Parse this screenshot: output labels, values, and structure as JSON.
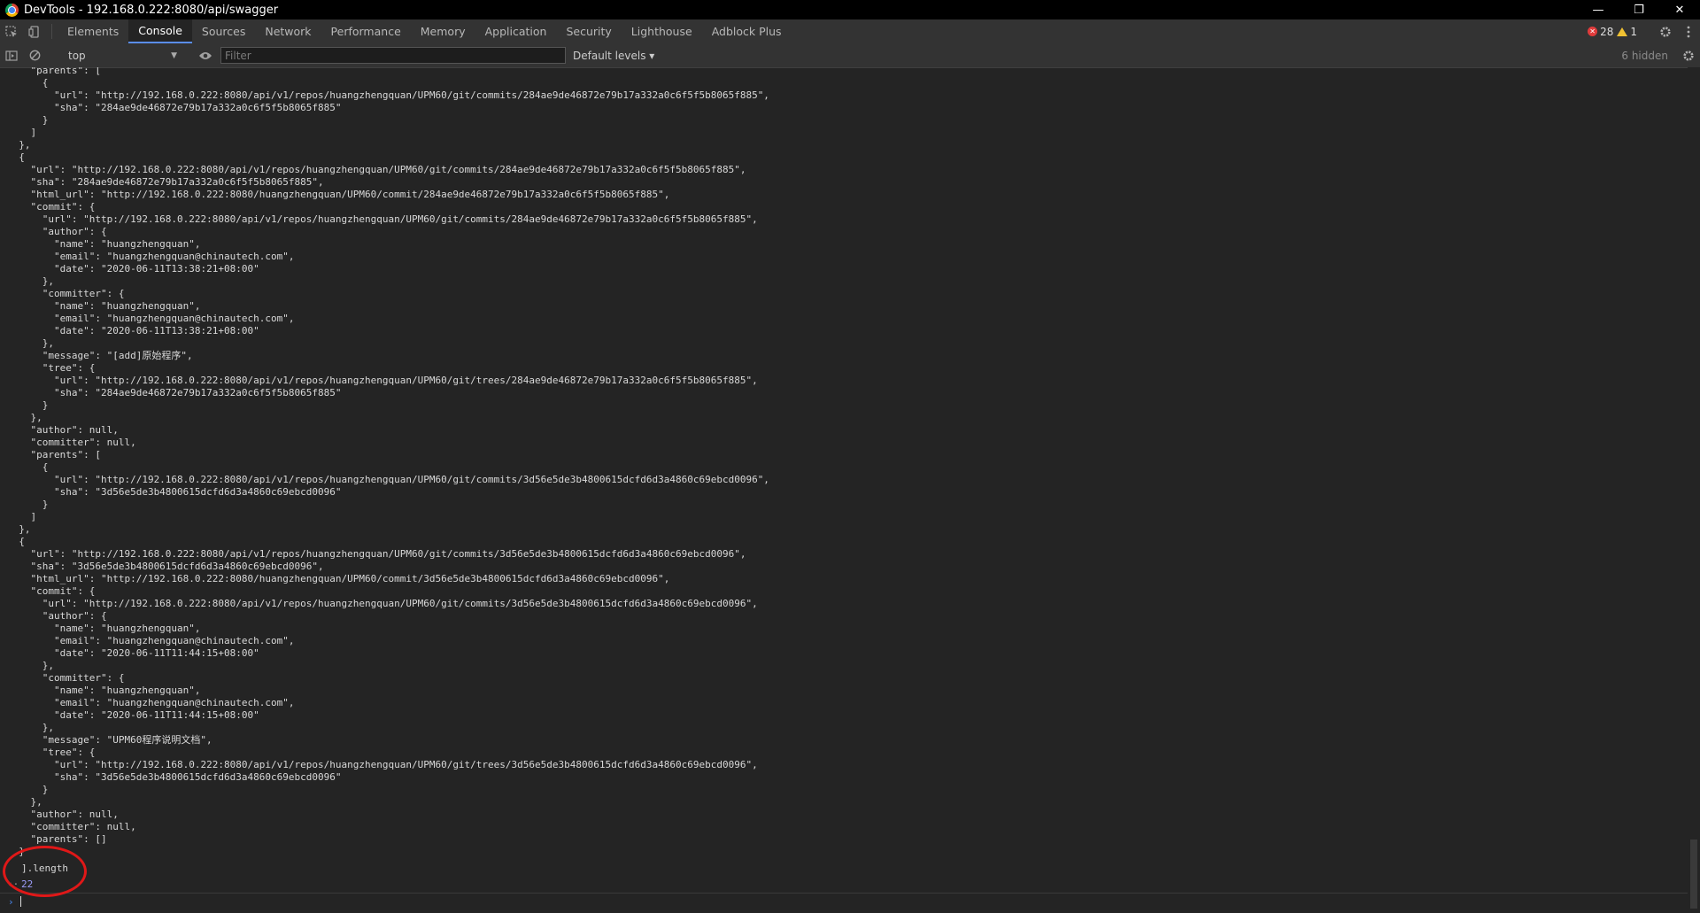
{
  "window": {
    "title": "DevTools - 192.168.0.222:8080/api/swagger",
    "minimize_glyph": "—",
    "restore_glyph": "❐",
    "close_glyph": "✕"
  },
  "tabs": [
    {
      "label": "Elements",
      "active": false
    },
    {
      "label": "Console",
      "active": true
    },
    {
      "label": "Sources",
      "active": false
    },
    {
      "label": "Network",
      "active": false
    },
    {
      "label": "Performance",
      "active": false
    },
    {
      "label": "Memory",
      "active": false
    },
    {
      "label": "Application",
      "active": false
    },
    {
      "label": "Security",
      "active": false
    },
    {
      "label": "Lighthouse",
      "active": false
    },
    {
      "label": "Adblock Plus",
      "active": false
    }
  ],
  "status": {
    "errors": "28",
    "warnings": "1"
  },
  "toolbar": {
    "context": "top",
    "filter_placeholder": "Filter",
    "levels": "Default levels ▾",
    "hidden": "6 hidden"
  },
  "console": {
    "lines": [
      "    \"parents\": [",
      "      {",
      "        \"url\": \"http://192.168.0.222:8080/api/v1/repos/huangzhengquan/UPM60/git/commits/284ae9de46872e79b17a332a0c6f5f5b8065f885\",",
      "        \"sha\": \"284ae9de46872e79b17a332a0c6f5f5b8065f885\"",
      "      }",
      "    ]",
      "  },",
      "  {",
      "    \"url\": \"http://192.168.0.222:8080/api/v1/repos/huangzhengquan/UPM60/git/commits/284ae9de46872e79b17a332a0c6f5f5b8065f885\",",
      "    \"sha\": \"284ae9de46872e79b17a332a0c6f5f5b8065f885\",",
      "    \"html_url\": \"http://192.168.0.222:8080/huangzhengquan/UPM60/commit/284ae9de46872e79b17a332a0c6f5f5b8065f885\",",
      "    \"commit\": {",
      "      \"url\": \"http://192.168.0.222:8080/api/v1/repos/huangzhengquan/UPM60/git/commits/284ae9de46872e79b17a332a0c6f5f5b8065f885\",",
      "      \"author\": {",
      "        \"name\": \"huangzhengquan\",",
      "        \"email\": \"huangzhengquan@chinautech.com\",",
      "        \"date\": \"2020-06-11T13:38:21+08:00\"",
      "      },",
      "      \"committer\": {",
      "        \"name\": \"huangzhengquan\",",
      "        \"email\": \"huangzhengquan@chinautech.com\",",
      "        \"date\": \"2020-06-11T13:38:21+08:00\"",
      "      },",
      "      \"message\": \"[add]原始程序\",",
      "      \"tree\": {",
      "        \"url\": \"http://192.168.0.222:8080/api/v1/repos/huangzhengquan/UPM60/git/trees/284ae9de46872e79b17a332a0c6f5f5b8065f885\",",
      "        \"sha\": \"284ae9de46872e79b17a332a0c6f5f5b8065f885\"",
      "      }",
      "    },",
      "    \"author\": null,",
      "    \"committer\": null,",
      "    \"parents\": [",
      "      {",
      "        \"url\": \"http://192.168.0.222:8080/api/v1/repos/huangzhengquan/UPM60/git/commits/3d56e5de3b4800615dcfd6d3a4860c69ebcd0096\",",
      "        \"sha\": \"3d56e5de3b4800615dcfd6d3a4860c69ebcd0096\"",
      "      }",
      "    ]",
      "  },",
      "  {",
      "    \"url\": \"http://192.168.0.222:8080/api/v1/repos/huangzhengquan/UPM60/git/commits/3d56e5de3b4800615dcfd6d3a4860c69ebcd0096\",",
      "    \"sha\": \"3d56e5de3b4800615dcfd6d3a4860c69ebcd0096\",",
      "    \"html_url\": \"http://192.168.0.222:8080/huangzhengquan/UPM60/commit/3d56e5de3b4800615dcfd6d3a4860c69ebcd0096\",",
      "    \"commit\": {",
      "      \"url\": \"http://192.168.0.222:8080/api/v1/repos/huangzhengquan/UPM60/git/commits/3d56e5de3b4800615dcfd6d3a4860c69ebcd0096\",",
      "      \"author\": {",
      "        \"name\": \"huangzhengquan\",",
      "        \"email\": \"huangzhengquan@chinautech.com\",",
      "        \"date\": \"2020-06-11T11:44:15+08:00\"",
      "      },",
      "      \"committer\": {",
      "        \"name\": \"huangzhengquan\",",
      "        \"email\": \"huangzhengquan@chinautech.com\",",
      "        \"date\": \"2020-06-11T11:44:15+08:00\"",
      "      },",
      "      \"message\": \"UPM60程序说明文档\",",
      "      \"tree\": {",
      "        \"url\": \"http://192.168.0.222:8080/api/v1/repos/huangzhengquan/UPM60/git/trees/3d56e5de3b4800615dcfd6d3a4860c69ebcd0096\",",
      "        \"sha\": \"3d56e5de3b4800615dcfd6d3a4860c69ebcd0096\"",
      "      }",
      "    },",
      "    \"author\": null,",
      "    \"committer\": null,",
      "    \"parents\": []",
      "  }"
    ],
    "length_expr": "].length",
    "result_arrow": "‹·",
    "result": "22",
    "prompt_caret": "›"
  },
  "colors": {
    "annotation_circle": "#e01818",
    "result_value": "#9d9dfa",
    "active_tab_underline": "#5a8ef0"
  }
}
